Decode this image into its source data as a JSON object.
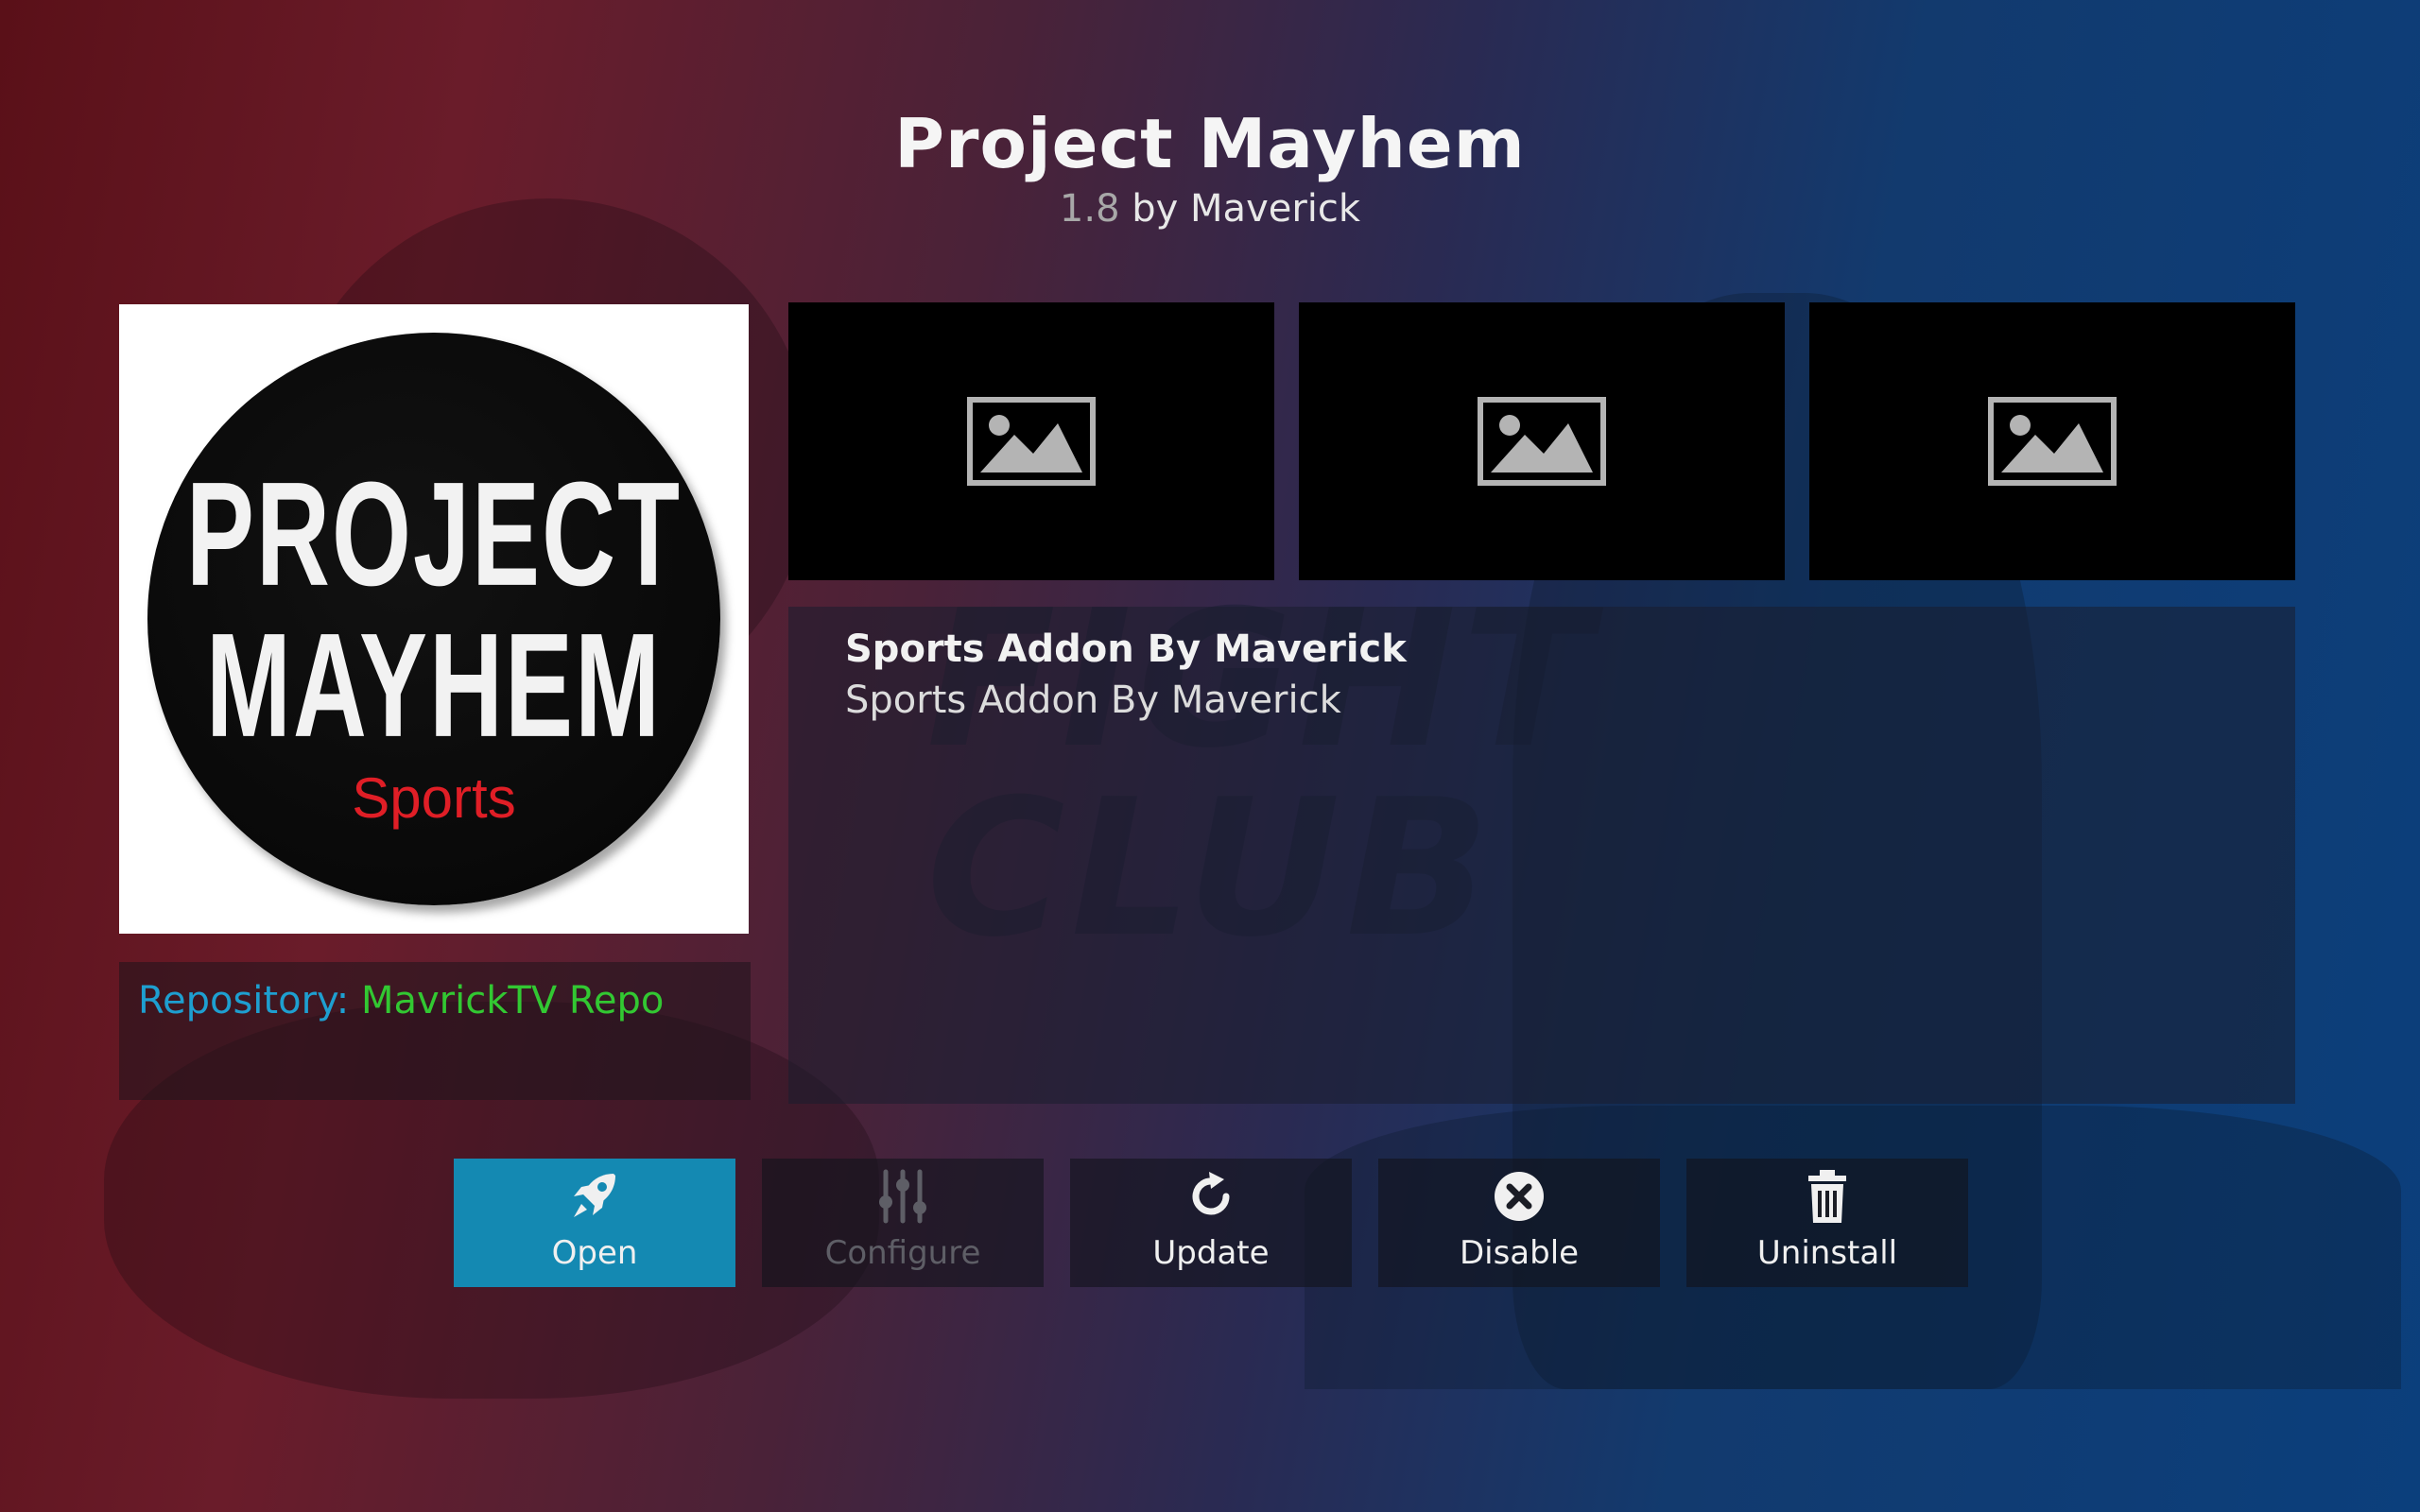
{
  "addon": {
    "title": "Project Mayhem",
    "version": "1.8",
    "by_author": "by Maverick"
  },
  "icon": {
    "line1": "PROJECT",
    "line2": "MAYHEM",
    "line3": "Sports"
  },
  "repository": {
    "label": "Repository:",
    "value": "MavrickTV Repo"
  },
  "screenshots": [
    {
      "icon": "image-placeholder-icon"
    },
    {
      "icon": "image-placeholder-icon"
    },
    {
      "icon": "image-placeholder-icon"
    }
  ],
  "description": {
    "summary": "Sports Addon By Maverick",
    "body": "Sports Addon By Maverick"
  },
  "actions": [
    {
      "label": "Open",
      "icon": "rocket-icon",
      "state": "focused"
    },
    {
      "label": "Configure",
      "icon": "sliders-icon",
      "state": "disabled"
    },
    {
      "label": "Update",
      "icon": "refresh-icon",
      "state": "normal"
    },
    {
      "label": "Disable",
      "icon": "x-circle-icon",
      "state": "normal"
    },
    {
      "label": "Uninstall",
      "icon": "trash-icon",
      "state": "normal"
    }
  ],
  "colors": {
    "focus_accent": "#1489b2",
    "repo_label": "#1e9fd0",
    "repo_value": "#32c832",
    "logo_red": "#e01e26"
  }
}
